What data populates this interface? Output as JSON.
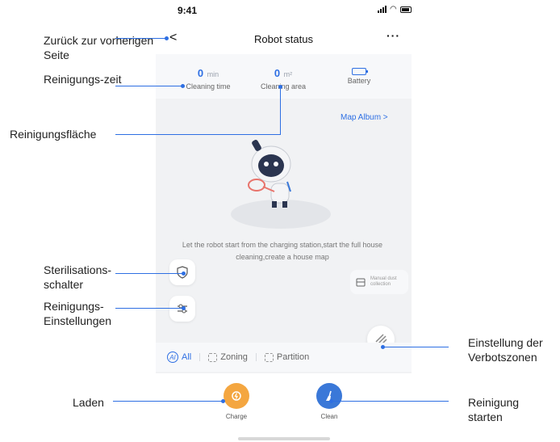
{
  "status_bar": {
    "time": "9:41"
  },
  "nav": {
    "back": "<",
    "title": "Robot status",
    "more": "···"
  },
  "stats": [
    {
      "value": "0",
      "unit": "min",
      "label": "Cleaning time"
    },
    {
      "value": "0",
      "unit": "m²",
      "label": "Cleaning area"
    },
    {
      "label": "Battery"
    }
  ],
  "map_album": "Map Album >",
  "hint": "Let the robot start from the charging station,start the full house cleaning,create a house map",
  "dust_collection": "Manual dust collection",
  "modes": [
    "All",
    "Zoning",
    "Partition"
  ],
  "ai_badge": "AI",
  "actions": {
    "charge": "Charge",
    "clean": "Clean"
  },
  "annotations": {
    "back": "Zurück zur vorherigen Seite",
    "time": "Reinigungs-zeit",
    "area": "Reinigungsfläche",
    "steril": "Sterilisations-schalter",
    "settings": "Reinigungs-Einstellungen",
    "nogo": "Einstellung der Verbotszonen",
    "charge": "Laden",
    "clean": "Reinigung starten"
  },
  "colors": {
    "accent": "#2e6fe3",
    "charge": "#f4a640",
    "clean": "#3a78d8"
  }
}
